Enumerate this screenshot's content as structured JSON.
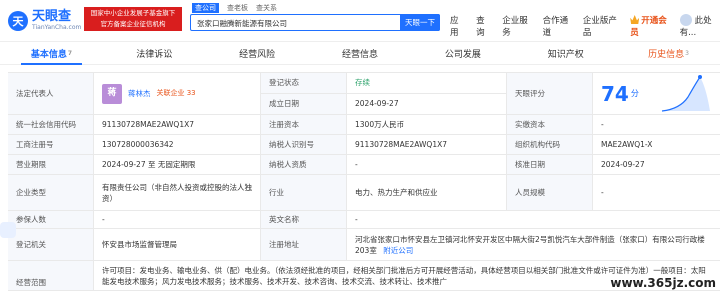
{
  "header": {
    "logo_char": "天",
    "logo_name": "天眼查",
    "logo_sub": "TianYanCha.com",
    "banner_line1": "国家中小企业发展子基金旗下",
    "banner_line2": "官方备案企业征信机构",
    "search_tabs": [
      "查公司",
      "查老板",
      "查关系"
    ],
    "search_value": "张家口融腾新能源有限公司",
    "search_button": "天眼一下",
    "nav": {
      "item1": "应用",
      "item2": "查询",
      "item3": "企业服务",
      "item4": "合作通道",
      "item5": "企业版产品",
      "vip": "开通会员",
      "user": "此处有..."
    }
  },
  "tabs": [
    {
      "label": "基本信息",
      "count": "7"
    },
    {
      "label": "法律诉讼",
      "count": ""
    },
    {
      "label": "经营风险",
      "count": ""
    },
    {
      "label": "经营信息",
      "count": ""
    },
    {
      "label": "公司发展",
      "count": ""
    },
    {
      "label": "知识产权",
      "count": ""
    },
    {
      "label": "历史信息",
      "count": "3"
    }
  ],
  "info": {
    "legal_rep_label": "法定代表人",
    "legal_rep_avatar": "蒋",
    "legal_rep_name": "蒋林杰",
    "legal_rep_related": "关联企业 33",
    "reg_status_label": "登记状态",
    "reg_status_value": "存续",
    "est_date_label": "成立日期",
    "est_date_value": "2024-09-27",
    "score_label": "天眼评分",
    "score_value": "74",
    "score_unit": "分",
    "credit_code_label": "统一社会信用代码",
    "credit_code_value": "91130728MAE2AWQ1X7",
    "reg_capital_label": "注册资本",
    "reg_capital_value": "1300万人民币",
    "paid_capital_label": "实缴资本",
    "paid_capital_value": "-",
    "biz_reg_no_label": "工商注册号",
    "biz_reg_no_value": "130728000036342",
    "tax_id_label": "纳税人识别号",
    "tax_id_value": "91130728MAE2AWQ1X7",
    "org_code_label": "组织机构代码",
    "org_code_value": "MAE2AWQ1-X",
    "term_label": "营业期限",
    "term_value": "2024-09-27 至 无固定期限",
    "taxpayer_qual_label": "纳税人资质",
    "taxpayer_qual_value": "-",
    "approval_date_label": "核准日期",
    "approval_date_value": "2024-09-27",
    "company_type_label": "企业类型",
    "company_type_value": "有限责任公司（非自然人投资或控股的法人独资）",
    "industry_label": "行业",
    "industry_value": "电力、热力生产和供应业",
    "staff_size_label": "人员规模",
    "staff_size_value": "-",
    "insured_label": "参保人数",
    "insured_value": "-",
    "en_name_label": "英文名称",
    "en_name_value": "-",
    "reg_authority_label": "登记机关",
    "reg_authority_value": "怀安县市场监督管理局",
    "reg_address_label": "注册地址",
    "reg_address_value": "河北省张家口市怀安县左卫镇河北怀安开发区中隔大街2号凯悦汽车大部件制造（张家口）有限公司行政楼203室",
    "nearby_link": "附近公司",
    "scope_label": "经营范围",
    "scope_value": "许可项目：发电业务、输电业务、供（配）电业务。（依法须经批准的项目，经相关部门批准后方可开展经营活动，具体经营项目以相关部门批准文件或许可证件为准）一般项目：太阳能发电技术服务；风力发电技术服务；技术服务、技术开发、技术咨询、技术交流、技术转让、技术推广"
  },
  "watermark": "www.365jz.com",
  "colors": {
    "brand": "#1f70ff",
    "active_status": "#2ea36c",
    "history": "#e8531a",
    "banner": "#d91e1e"
  }
}
